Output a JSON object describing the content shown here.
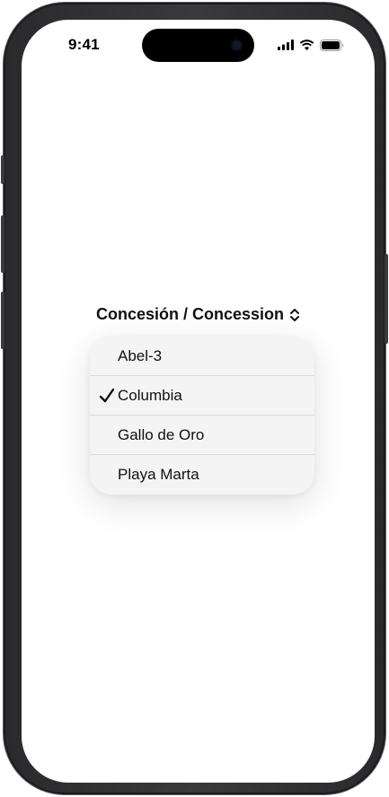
{
  "status_bar": {
    "time": "9:41",
    "icons": [
      "cellular-signal-icon",
      "wifi-icon",
      "battery-icon"
    ]
  },
  "picker": {
    "label": "Concesión / Concession",
    "icon": "chevron-up-down-icon"
  },
  "menu": {
    "items": [
      {
        "label": "Abel-3",
        "selected": false
      },
      {
        "label": "Columbia",
        "selected": true
      },
      {
        "label": "Gallo de Oro",
        "selected": false
      },
      {
        "label": "Playa Marta",
        "selected": false
      }
    ],
    "selected_icon": "checkmark-icon"
  }
}
